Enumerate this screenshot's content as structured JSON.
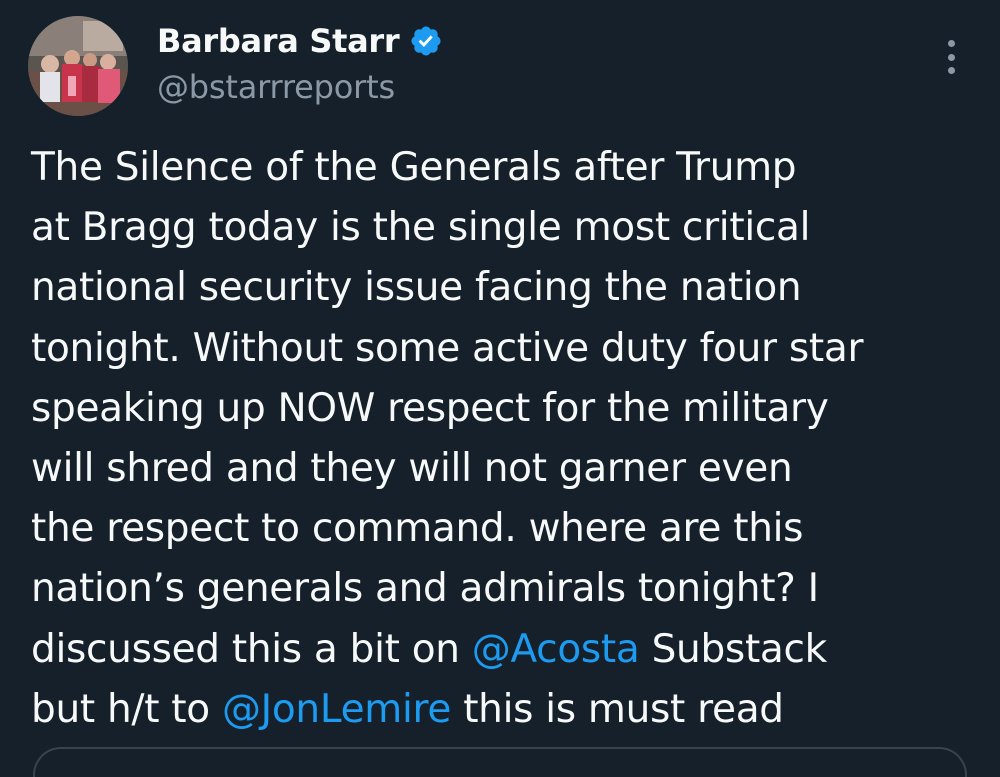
{
  "author": {
    "display_name": "Barbara Starr",
    "handle": "@bstarrreports",
    "verified": true,
    "avatar_icon": "profile-photo"
  },
  "menu_icon": "more-vertical-icon",
  "tweet": {
    "lines": [
      [
        {
          "text": "The Silence of the Generals after Trump",
          "type": "text"
        }
      ],
      [
        {
          "text": "at Bragg today is the single most critical",
          "type": "text"
        }
      ],
      [
        {
          "text": "national security issue facing the nation",
          "type": "text"
        }
      ],
      [
        {
          "text": "tonight. Without some active duty four star",
          "type": "text"
        }
      ],
      [
        {
          "text": "speaking up NOW respect for the military",
          "type": "text"
        }
      ],
      [
        {
          "text": "will shred and they will not garner even",
          "type": "text"
        }
      ],
      [
        {
          "text": "the respect to command. where are this",
          "type": "text"
        }
      ],
      [
        {
          "text": "nation’s generals and admirals tonight? I",
          "type": "text"
        }
      ],
      [
        {
          "text": "discussed this a bit on ",
          "type": "text"
        },
        {
          "text": "@Acosta",
          "type": "mention"
        },
        {
          "text": " Substack",
          "type": "text"
        }
      ],
      [
        {
          "text": "but h/t to ",
          "type": "text"
        },
        {
          "text": "@JonLemire",
          "type": "mention"
        },
        {
          "text": " this is must read",
          "type": "text"
        }
      ]
    ]
  },
  "colors": {
    "background": "#15202b",
    "text": "#f7f9f9",
    "secondary_text": "#8b98a5",
    "accent": "#1d9bf0",
    "border": "#38444d"
  }
}
